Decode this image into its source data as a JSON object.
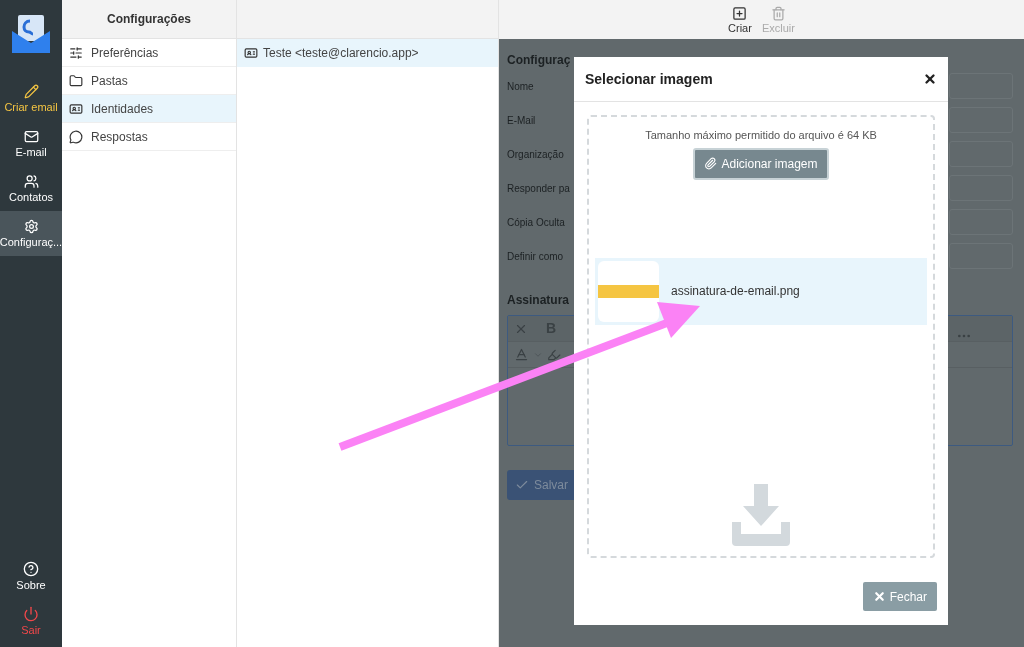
{
  "nav": {
    "items": [
      {
        "kind": "accent",
        "label": "Criar email",
        "selected": false
      },
      {
        "kind": "default",
        "label": "E-mail",
        "selected": false
      },
      {
        "kind": "default",
        "label": "Contatos",
        "selected": false
      },
      {
        "kind": "default",
        "label": "Configuraç...",
        "selected": true
      }
    ],
    "bottom_items": [
      {
        "kind": "default",
        "label": "Sobre"
      },
      {
        "kind": "danger",
        "label": "Sair"
      }
    ]
  },
  "settings_menu": {
    "title": "Configurações",
    "items": [
      {
        "label": "Preferências",
        "selected": false
      },
      {
        "label": "Pastas",
        "selected": false
      },
      {
        "label": "Identidades",
        "selected": true
      },
      {
        "label": "Respostas",
        "selected": false
      }
    ]
  },
  "identities": [
    {
      "label": "Teste <teste@clarencio.app>",
      "selected": true
    }
  ],
  "toolbar": [
    {
      "label": "Criar",
      "disabled": false
    },
    {
      "label": "Excluir",
      "disabled": true
    }
  ],
  "form": {
    "title": "Configuraç",
    "fields": [
      "Nome",
      "E-Mail",
      "Organização",
      "Responder pa",
      "Cópia Oculta",
      "Definir como"
    ],
    "signature_label": "Assinatura",
    "editor_bold": "B",
    "save": "Salvar"
  },
  "dialog": {
    "title": "Selecionar imagem",
    "hint": "Tamanho máximo permitido do arquivo é 64 KB",
    "add_button": "Adicionar imagem",
    "files": [
      {
        "name": "assinatura-de-email.png",
        "selected": true
      }
    ],
    "close_button": "Fechar"
  }
}
